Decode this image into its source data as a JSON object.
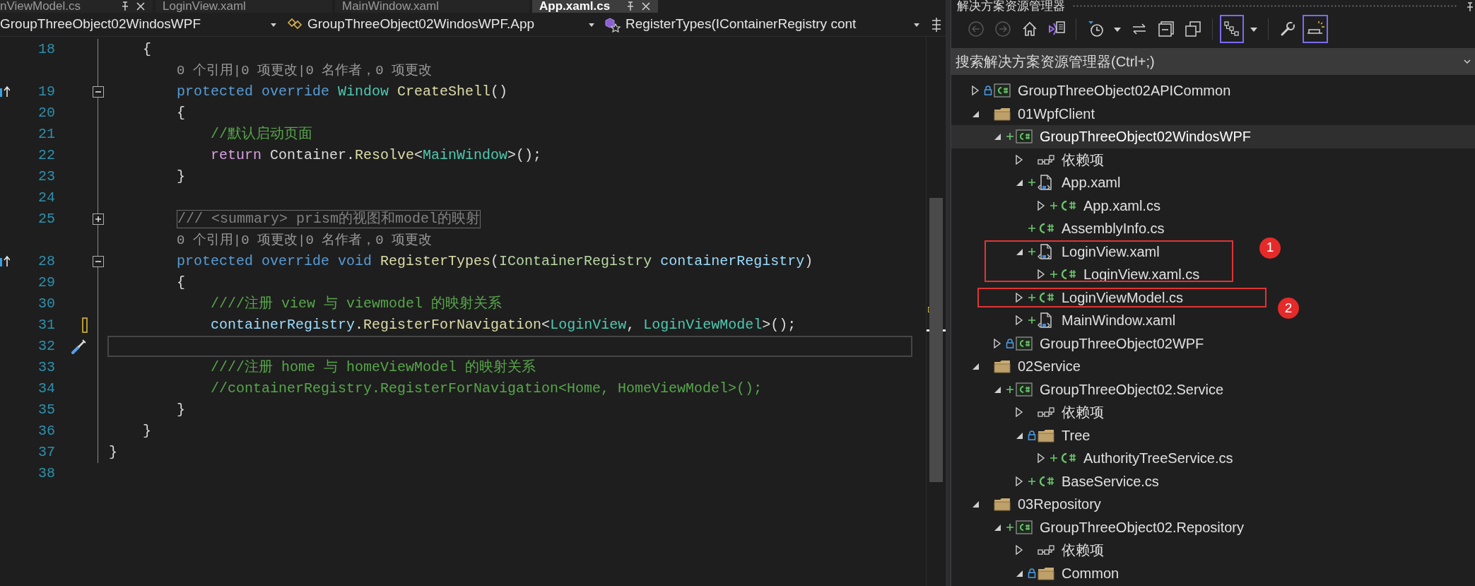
{
  "editor_tabs": [
    {
      "label": "nViewModel.cs",
      "selected": false,
      "closable": true
    },
    {
      "label": "LoginView.xaml",
      "selected": false
    },
    {
      "label": "MainWindow.xaml",
      "selected": false
    },
    {
      "label": "App.xaml.cs",
      "selected": true,
      "closable": true
    }
  ],
  "navigation": {
    "project": "GroupThreeObject02WindosWPF",
    "class": "GroupThreeObject02WindosWPF.App",
    "member": "RegisterTypes(IContainerRegistry cont"
  },
  "editor": {
    "rows": [
      {
        "kind": "code",
        "number": "18",
        "tokens": [
          {
            "kind": "plain",
            "text": "    {"
          }
        ]
      },
      {
        "kind": "codelens",
        "text": "0 个引用|0 项更改|0 名作者，0 项更改"
      },
      {
        "kind": "code",
        "number": "19",
        "collapsed": false,
        "override": true,
        "tokens": [
          {
            "kind": "keyword",
            "text": "        protected override "
          },
          {
            "kind": "type",
            "text": "Window "
          },
          {
            "kind": "method",
            "text": "CreateShell"
          },
          {
            "kind": "plain",
            "text": "()"
          }
        ]
      },
      {
        "kind": "code",
        "number": "20",
        "tokens": [
          {
            "kind": "plain",
            "text": "        {"
          }
        ]
      },
      {
        "kind": "code",
        "number": "21",
        "tokens": [
          {
            "kind": "comment",
            "text": "            //默认启动页面"
          }
        ]
      },
      {
        "kind": "code",
        "number": "22",
        "tokens": [
          {
            "kind": "control",
            "text": "            return"
          },
          {
            "kind": "plain",
            "text": " Container."
          },
          {
            "kind": "method",
            "text": "Resolve"
          },
          {
            "kind": "plain",
            "text": "<"
          },
          {
            "kind": "type",
            "text": "MainWindow"
          },
          {
            "kind": "plain",
            "text": ">();"
          }
        ]
      },
      {
        "kind": "code",
        "number": "23",
        "tokens": [
          {
            "kind": "plain",
            "text": "        }"
          }
        ]
      },
      {
        "kind": "code",
        "number": "24",
        "tokens": []
      },
      {
        "kind": "code",
        "number": "25",
        "collapsed": true,
        "tokens": [
          {
            "kind": "collapsed",
            "text": "        /// <summary> prism的视图和model的映射"
          }
        ]
      },
      {
        "kind": "codelens",
        "text": "0 个引用|0 项更改|0 名作者，0 项更改"
      },
      {
        "kind": "code",
        "number": "28",
        "collapsed": false,
        "override": true,
        "tokens": [
          {
            "kind": "keyword",
            "text": "        protected override void "
          },
          {
            "kind": "method",
            "text": "RegisterTypes"
          },
          {
            "kind": "plain",
            "text": "("
          },
          {
            "kind": "interface",
            "text": "IContainerRegistry "
          },
          {
            "kind": "param",
            "text": "containerRegistry"
          },
          {
            "kind": "plain",
            "text": ")"
          }
        ]
      },
      {
        "kind": "code",
        "number": "29",
        "tokens": [
          {
            "kind": "plain",
            "text": "        {"
          }
        ]
      },
      {
        "kind": "code",
        "number": "30",
        "tokens": [
          {
            "kind": "comment",
            "text": "            ////注册 view 与 viewmodel 的映射关系"
          }
        ]
      },
      {
        "kind": "code",
        "number": "31",
        "changed": true,
        "tokens": [
          {
            "kind": "param",
            "text": "            containerRegistry"
          },
          {
            "kind": "plain",
            "text": "."
          },
          {
            "kind": "method",
            "text": "RegisterForNavigation"
          },
          {
            "kind": "plain",
            "text": "<"
          },
          {
            "kind": "type",
            "text": "LoginView"
          },
          {
            "kind": "plain",
            "text": ", "
          },
          {
            "kind": "type",
            "text": "LoginViewModel"
          },
          {
            "kind": "plain",
            "text": ">();"
          }
        ]
      },
      {
        "kind": "code",
        "number": "32",
        "current": true,
        "quick_action": true,
        "tokens": []
      },
      {
        "kind": "code",
        "number": "33",
        "tokens": [
          {
            "kind": "comment",
            "text": "            ////注册 home 与 homeViewModel 的映射关系"
          }
        ]
      },
      {
        "kind": "code",
        "number": "34",
        "tokens": [
          {
            "kind": "comment",
            "text": "            //containerRegistry.RegisterForNavigation<Home, HomeViewModel>();"
          }
        ]
      },
      {
        "kind": "code",
        "number": "35",
        "tokens": [
          {
            "kind": "plain",
            "text": "        }"
          }
        ]
      },
      {
        "kind": "code",
        "number": "36",
        "tokens": [
          {
            "kind": "plain",
            "text": "    }"
          }
        ]
      },
      {
        "kind": "code",
        "number": "37",
        "tokens": [
          {
            "kind": "plain",
            "text": "}"
          }
        ]
      },
      {
        "kind": "code",
        "number": "38",
        "tokens": []
      }
    ]
  },
  "solution_explorer": {
    "title": "解决方案资源管理器",
    "toolbar": [
      [
        {
          "kind": "back",
          "disabled": true,
          "selected": false
        },
        {
          "kind": "forward",
          "disabled": true,
          "selected": false
        },
        {
          "kind": "home",
          "disabled": false,
          "selected": false
        },
        {
          "kind": "switch_views",
          "disabled": false,
          "selected": false
        }
      ],
      [
        {
          "kind": "pending_changes",
          "disabled": false,
          "selected": false
        },
        {
          "kind": "menu",
          "disabled": false,
          "selected": false
        },
        {
          "kind": "sync",
          "disabled": false,
          "selected": false
        },
        {
          "kind": "collapse_all",
          "disabled": false,
          "selected": false
        },
        {
          "kind": "show_all_files",
          "disabled": false,
          "selected": false
        }
      ],
      [
        {
          "kind": "tree_view",
          "disabled": false,
          "selected": true
        },
        {
          "kind": "menu",
          "disabled": false,
          "selected": false
        }
      ],
      [
        {
          "kind": "properties",
          "disabled": false,
          "selected": false
        },
        {
          "kind": "preview",
          "disabled": false,
          "selected": true
        }
      ]
    ],
    "search": {
      "placeholder": "搜索解决方案资源管理器(Ctrl+;)"
    },
    "tree": [
      {
        "label": "GroupThreeObject02APICommon",
        "kind": "project",
        "expanded": false,
        "locked": true,
        "selected": false
      },
      {
        "label": "01WpfClient",
        "kind": "folder",
        "expanded": true,
        "selected": false,
        "children": [
          {
            "label": "GroupThreeObject02WindosWPF",
            "kind": "project",
            "expanded": true,
            "added": true,
            "selected": true,
            "children": [
              {
                "label": "依赖项",
                "kind": "dependencies",
                "expanded": false,
                "selected": false
              },
              {
                "label": "App.xaml",
                "kind": "xaml",
                "expanded": true,
                "added": true,
                "selected": false,
                "children": [
                  {
                    "label": "App.xaml.cs",
                    "kind": "cs",
                    "expanded": false,
                    "added": true,
                    "selected": false
                  }
                ]
              },
              {
                "label": "AssemblyInfo.cs",
                "kind": "cs",
                "added": true,
                "selected": false
              },
              {
                "label": "LoginView.xaml",
                "kind": "xaml",
                "expanded": true,
                "added": true,
                "selected": false,
                "callout": "1",
                "children": [
                  {
                    "label": "LoginView.xaml.cs",
                    "kind": "cs",
                    "expanded": false,
                    "added": true,
                    "selected": false
                  }
                ]
              },
              {
                "label": "LoginViewModel.cs",
                "kind": "cs",
                "expanded": false,
                "added": true,
                "selected": false,
                "callout": "2"
              },
              {
                "label": "MainWindow.xaml",
                "kind": "xaml",
                "expanded": false,
                "added": true,
                "selected": false
              }
            ]
          },
          {
            "label": "GroupThreeObject02WPF",
            "kind": "project",
            "expanded": false,
            "locked": true,
            "selected": false
          }
        ]
      },
      {
        "label": "02Service",
        "kind": "folder",
        "expanded": true,
        "selected": false,
        "children": [
          {
            "label": "GroupThreeObject02.Service",
            "kind": "project",
            "expanded": true,
            "added": true,
            "selected": false,
            "children": [
              {
                "label": "依赖项",
                "kind": "dependencies",
                "expanded": false,
                "selected": false
              },
              {
                "label": "Tree",
                "kind": "folder",
                "expanded": true,
                "locked": true,
                "selected": false,
                "children": [
                  {
                    "label": "AuthorityTreeService.cs",
                    "kind": "cs",
                    "expanded": false,
                    "added": true,
                    "selected": false
                  }
                ]
              },
              {
                "label": "BaseService.cs",
                "kind": "cs",
                "expanded": false,
                "added": true,
                "selected": false
              }
            ]
          }
        ]
      },
      {
        "label": "03Repository",
        "kind": "folder",
        "expanded": true,
        "selected": false,
        "children": [
          {
            "label": "GroupThreeObject02.Repository",
            "kind": "project",
            "expanded": true,
            "added": true,
            "selected": false,
            "children": [
              {
                "label": "依赖项",
                "kind": "dependencies",
                "expanded": false,
                "selected": false
              },
              {
                "label": "Common",
                "kind": "folder",
                "expanded": true,
                "locked": true,
                "selected": false
              }
            ]
          }
        ]
      }
    ]
  }
}
